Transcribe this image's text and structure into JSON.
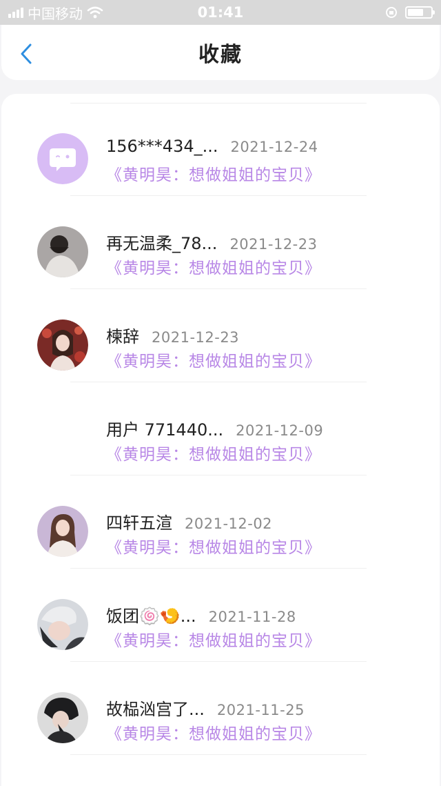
{
  "status_bar": {
    "carrier": "中国移动",
    "time": "01:41",
    "battery_level": 0.7
  },
  "nav": {
    "title": "收藏",
    "back_icon": "chevron-left-icon"
  },
  "colors": {
    "accent": "#b887e6",
    "back_icon": "#2d8ee0",
    "avatar_default": "#d8bcf5"
  },
  "items": [
    {
      "name": "156***434_...",
      "date": "2021-12-24",
      "work": "《黄明昊：想做姐姐的宝贝》",
      "avatar": "default-chat-avatar-icon"
    },
    {
      "name": "再无温柔_78...",
      "date": "2021-12-23",
      "work": "《黄明昊：想做姐姐的宝贝》",
      "avatar": "user-avatar-photo"
    },
    {
      "name": "楝辞",
      "date": "2021-12-23",
      "work": "《黄明昊：想做姐姐的宝贝》",
      "avatar": "user-avatar-photo"
    },
    {
      "name": "用户 771440...",
      "date": "2021-12-09",
      "work": "《黄明昊：想做姐姐的宝贝》",
      "avatar": "none"
    },
    {
      "name": "四轩五渲",
      "date": "2021-12-02",
      "work": "《黄明昊：想做姐姐的宝贝》",
      "avatar": "user-avatar-photo"
    },
    {
      "name": "饭团🍥🍤...",
      "date": "2021-11-28",
      "work": "《黄明昊：想做姐姐的宝贝》",
      "avatar": "user-avatar-photo"
    },
    {
      "name": "故榀汹宫了...",
      "date": "2021-11-25",
      "work": "《黄明昊：想做姐姐的宝贝》",
      "avatar": "user-avatar-photo"
    }
  ]
}
